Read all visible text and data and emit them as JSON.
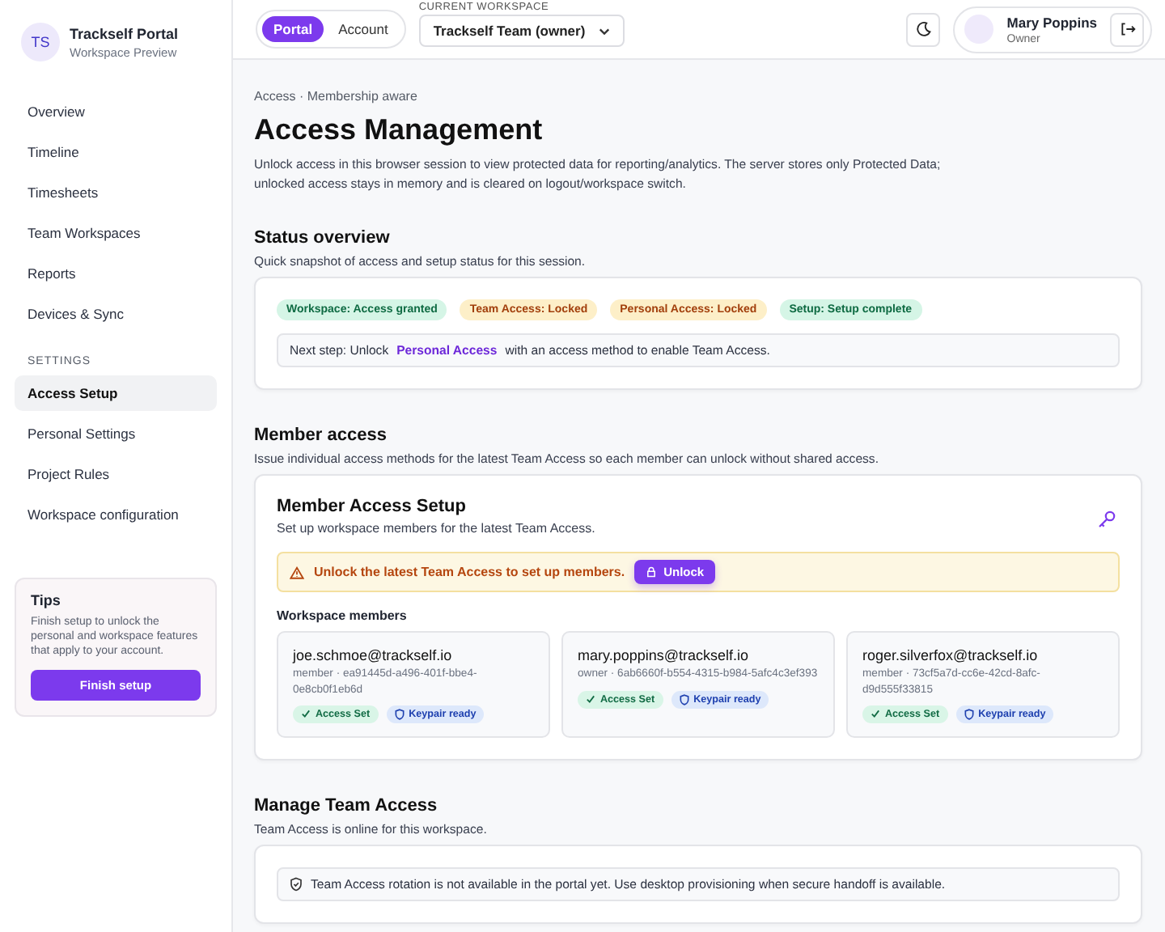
{
  "brand": {
    "initials": "TS",
    "name": "Trackself Portal",
    "subtitle": "Workspace Preview"
  },
  "nav": [
    {
      "label": "Overview",
      "selected": false
    },
    {
      "label": "Timeline",
      "selected": false
    },
    {
      "label": "Timesheets",
      "selected": false
    },
    {
      "label": "Team Workspaces",
      "selected": false
    },
    {
      "label": "Reports",
      "selected": false
    },
    {
      "label": "Devices & Sync",
      "selected": false
    }
  ],
  "settings_heading": "SETTINGS",
  "settings_nav": [
    {
      "label": "Access Setup",
      "selected": true
    },
    {
      "label": "Personal Settings",
      "selected": false
    },
    {
      "label": "Project Rules",
      "selected": false
    },
    {
      "label": "Workspace configuration",
      "selected": false
    }
  ],
  "tips": {
    "title": "Tips",
    "text": "Finish setup to unlock the personal and workspace features that apply to your account.",
    "button": "Finish setup"
  },
  "mode_tabs": [
    {
      "label": "Portal",
      "selected": true
    },
    {
      "label": "Account",
      "selected": false
    }
  ],
  "workspace": {
    "label": "CURRENT WORKSPACE",
    "value": "Trackself Team (owner)"
  },
  "user": {
    "name": "Mary Poppins",
    "role": "Owner"
  },
  "breadcrumb": "Access · Membership aware",
  "title": "Access Management",
  "description": "Unlock access in this browser session to view protected data for reporting/analytics. The server stores only Protected Data; unlocked access stays in memory and is cleared on logout/workspace switch.",
  "status_overview": {
    "heading": "Status overview",
    "subtitle": "Quick snapshot of access and setup status for this session.",
    "badges": [
      {
        "label": "Workspace: Access granted",
        "kind": "good"
      },
      {
        "label": "Team Access: Locked",
        "kind": "warn"
      },
      {
        "label": "Personal Access: Locked",
        "kind": "warn"
      },
      {
        "label": "Setup: Setup complete",
        "kind": "good"
      }
    ],
    "next_step": "Next step: Unlock **Personal Access** with an access method to enable Team Access."
  },
  "member_access": {
    "heading": "Member access",
    "subtitle": "Issue individual access methods for the latest Team Access so each member can unlock without shared access.",
    "card_title": "Member Access Setup",
    "card_subtitle": "Set up workspace members for the latest Team Access.",
    "warning": "Unlock the latest Team Access to set up members.",
    "unlock_button": "Unlock",
    "members_heading": "Workspace members",
    "members": [
      {
        "email": "joe.schmoe@trackself.io",
        "meta": "member · ea91445d-a496-401f-bbe4-0e8cb0f1eb6d",
        "tags": [
          {
            "label": "Access Set",
            "kind": "access"
          },
          {
            "label": "Keypair ready",
            "kind": "keypair"
          }
        ]
      },
      {
        "email": "mary.poppins@trackself.io",
        "meta": "owner · 6ab6660f-b554-4315-b984-5afc4c3ef393",
        "tags": [
          {
            "label": "Access Set",
            "kind": "access"
          },
          {
            "label": "Keypair ready",
            "kind": "keypair"
          }
        ]
      },
      {
        "email": "roger.silverfox@trackself.io",
        "meta": "member · 73cf5a7d-cc6e-42cd-8afc-d9d555f33815",
        "tags": [
          {
            "label": "Access Set",
            "kind": "access"
          },
          {
            "label": "Keypair ready",
            "kind": "keypair"
          }
        ]
      }
    ]
  },
  "manage": {
    "heading": "Manage Team Access",
    "subtitle": "Team Access is online for this workspace.",
    "notice": "Team Access rotation is not available in the portal yet. Use desktop provisioning when secure handoff is available."
  }
}
